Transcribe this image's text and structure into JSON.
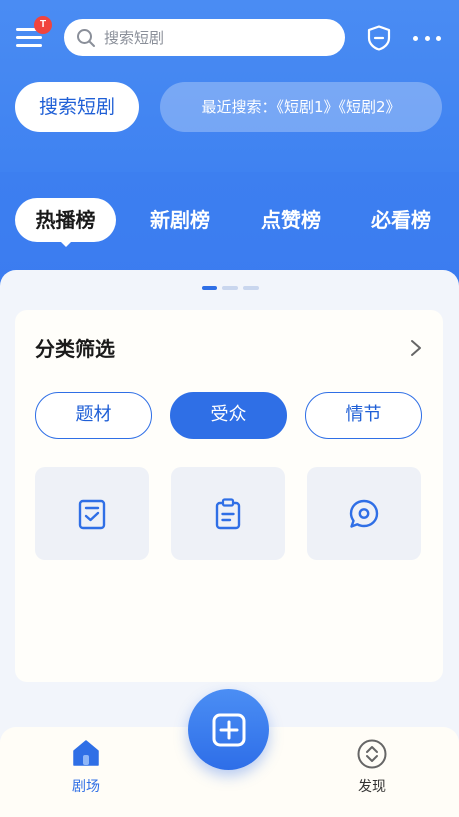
{
  "header": {
    "menu_badge": "T",
    "search_placeholder": "搜索短剧"
  },
  "quick": {
    "search_button": "搜索短剧",
    "recent_text": "最近搜索：《短剧1》《短剧2》"
  },
  "tabs": [
    {
      "label": "热播榜",
      "active": true
    },
    {
      "label": "新剧榜",
      "active": false
    },
    {
      "label": "点赞榜",
      "active": false
    },
    {
      "label": "必看榜",
      "active": false
    }
  ],
  "filter": {
    "title": "分类筛选",
    "chips": [
      {
        "label": "题材",
        "active": false
      },
      {
        "label": "受众",
        "active": true
      },
      {
        "label": "情节",
        "active": false
      }
    ],
    "tiles": [
      "checklist-icon",
      "clipboard-icon",
      "chat-bubble-icon"
    ]
  },
  "bottom_nav": {
    "left_label": "剧场",
    "right_label": "发现",
    "center_icon": "plus-square-icon"
  },
  "colors": {
    "primary": "#2f6fe6",
    "header_blue": "#4a8cf3",
    "badge_red": "#f0443e"
  }
}
